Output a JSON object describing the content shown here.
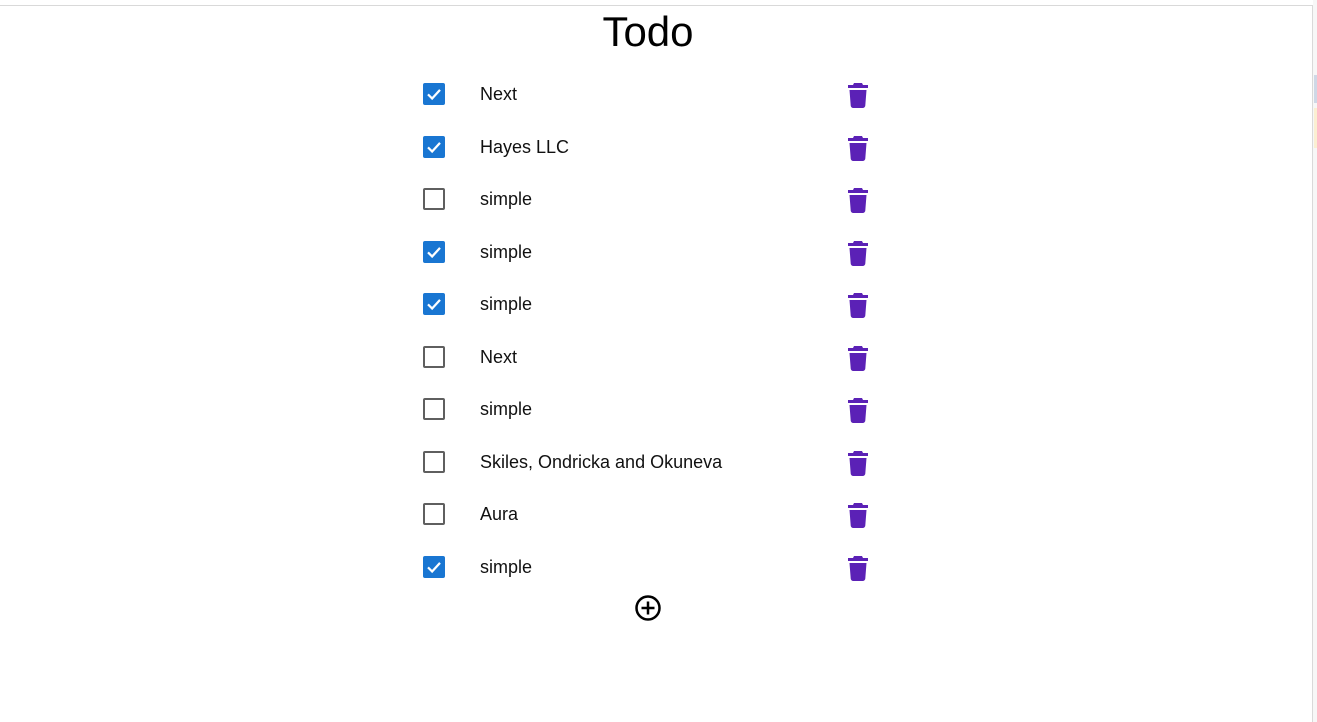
{
  "app": {
    "title": "Todo"
  },
  "colors": {
    "checkbox_checked": "#1976d2",
    "checkbox_unchecked_border": "#5f5f5f",
    "delete_icon": "#5b21b6",
    "add_icon": "#000000"
  },
  "todos": [
    {
      "label": "Next",
      "checked": true
    },
    {
      "label": "Hayes LLC",
      "checked": true
    },
    {
      "label": "simple",
      "checked": false
    },
    {
      "label": "simple",
      "checked": true
    },
    {
      "label": "simple",
      "checked": true
    },
    {
      "label": "Next",
      "checked": false
    },
    {
      "label": "simple",
      "checked": false
    },
    {
      "label": "Skiles, Ondricka and Okuneva",
      "checked": false
    },
    {
      "label": "Aura",
      "checked": false
    },
    {
      "label": "simple",
      "checked": true
    }
  ],
  "icons": {
    "delete": "trash-icon",
    "add": "add-circle-icon",
    "check": "check-icon"
  }
}
